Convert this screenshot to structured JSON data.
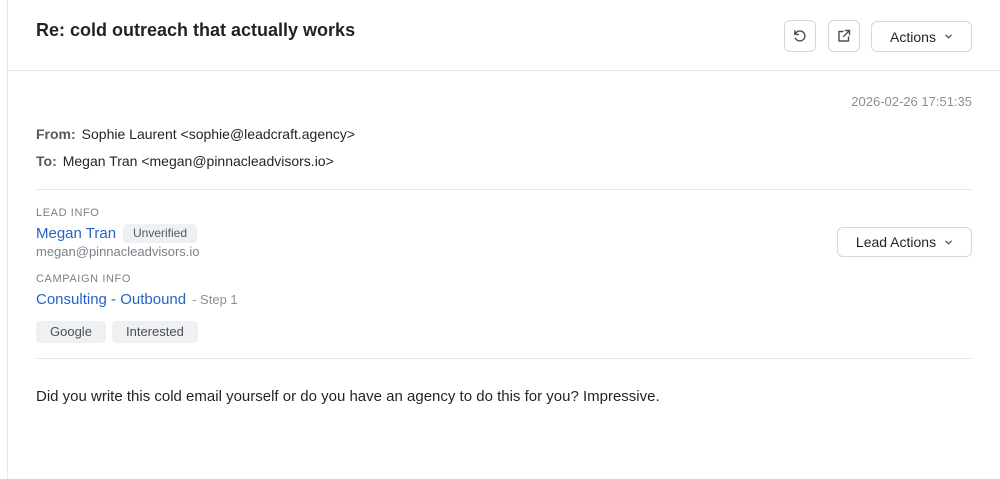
{
  "email": {
    "subject": "Re: cold outreach that actually works",
    "timestamp": "2026-02-26 17:51:35",
    "from_label": "From:",
    "from_value": "Sophie Laurent <sophie@leadcraft.agency>",
    "to_label": "To:",
    "to_value": "Megan Tran <megan@pinnacleadvisors.io>",
    "body": "Did you write this cold email yourself or do you have an agency to do this for you? Impressive."
  },
  "toolbar": {
    "actions_label": "Actions",
    "refresh_icon": "refresh-icon",
    "open_icon": "external-link-icon"
  },
  "lead": {
    "section_label": "LEAD INFO",
    "name": "Megan Tran",
    "status": "Unverified",
    "email": "megan@pinnacleadvisors.io",
    "actions_label": "Lead Actions"
  },
  "campaign": {
    "section_label": "CAMPAIGN INFO",
    "name": "Consulting - Outbound",
    "step": "- Step 1",
    "tags": [
      "Google",
      "Interested"
    ]
  },
  "colors": {
    "link": "#2563c9",
    "border": "#d5d8dc",
    "badge_bg": "#eef0f2"
  }
}
